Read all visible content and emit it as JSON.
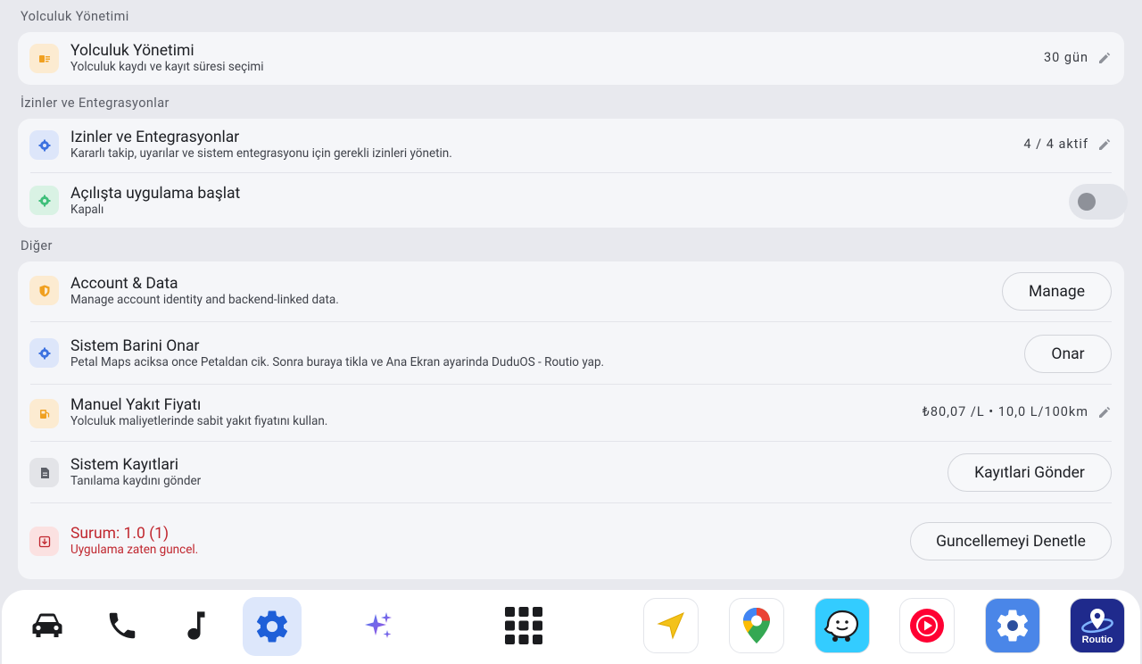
{
  "sections": {
    "trip": {
      "title": "Yolculuk Yönetimi"
    },
    "permissions": {
      "title": "İzinler ve Entegrasyonlar"
    },
    "other": {
      "title": "Diğer"
    }
  },
  "trip_management": {
    "title": "Yolculuk Yönetimi",
    "subtitle": "Yolculuk kaydı ve kayıt süresi seçimi",
    "value": "30 gün"
  },
  "permissions_row": {
    "title": "Izinler ve Entegrasyonlar",
    "subtitle": "Kararlı takip, uyarılar ve sistem entegrasyonu için gerekli izinleri yönetin.",
    "value": "4 / 4 aktif"
  },
  "autostart": {
    "title": "Açılışta uygulama başlat",
    "subtitle": "Kapalı",
    "enabled": false
  },
  "account": {
    "title": "Account & Data",
    "subtitle": "Manage account identity and backend-linked data.",
    "button": "Manage"
  },
  "repair": {
    "title": "Sistem Barini Onar",
    "subtitle": "Petal Maps aciksa once Petaldan cik. Sonra buraya tikla ve Ana Ekran ayarinda DuduOS - Routio yap.",
    "button": "Onar"
  },
  "fuel": {
    "title": "Manuel Yakıt Fiyatı",
    "subtitle": "Yolculuk maliyetlerinde sabit yakıt fiyatını kullan.",
    "value": "₺80,07 /L • 10,0 L/100km"
  },
  "logs": {
    "title": "Sistem Kayıtlari",
    "subtitle": "Tanılama kaydını gönder",
    "button": "Kayıtlari Gönder"
  },
  "version": {
    "title": "Surum: 1.0 (1)",
    "subtitle": "Uygulama zaten guncel.",
    "button": "Guncellemeyi Denetle"
  },
  "dock": {
    "items": [
      "car-icon",
      "phone-icon",
      "music-icon",
      "settings-icon",
      "sparkle-icon",
      "app-grid-icon"
    ],
    "apps": [
      "navigation-app",
      "maps-app",
      "waze-app",
      "youtube-music-app",
      "system-settings-app",
      "routio-app"
    ],
    "routio_label": "Routio"
  },
  "colors": {
    "accent": "#2f6fe0",
    "danger": "#c0262e",
    "orange": "#f0a020",
    "green": "#3fbf7a"
  }
}
